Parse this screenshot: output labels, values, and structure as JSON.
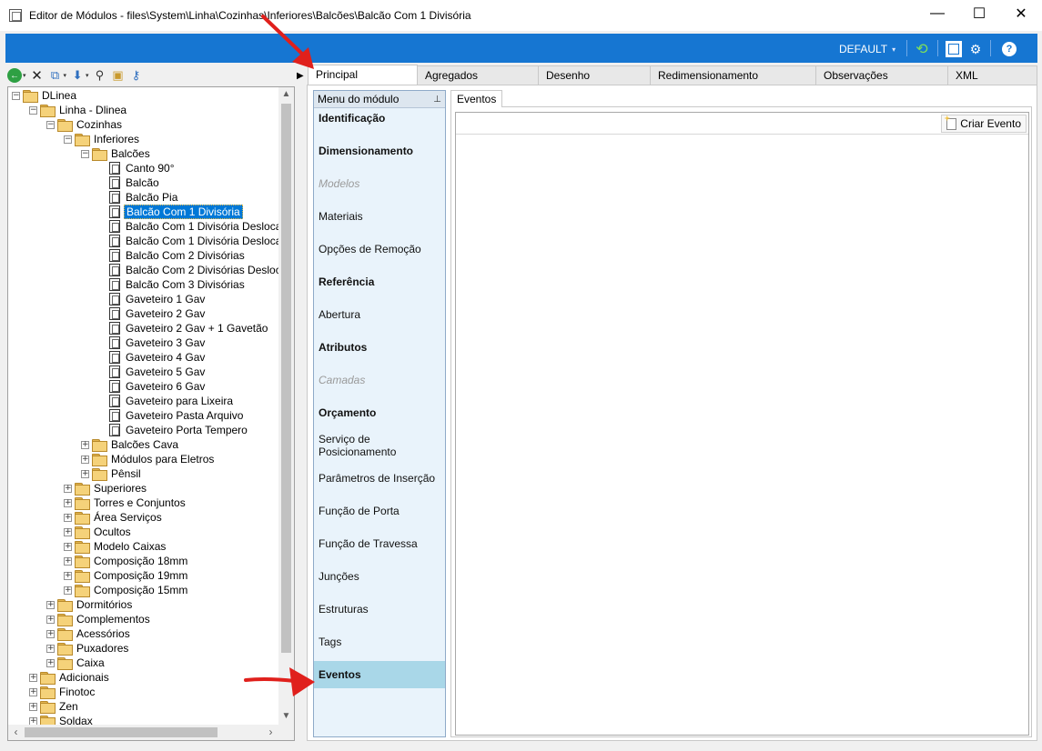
{
  "window": {
    "title": "Editor de Módulos - files\\System\\Linha\\Cozinhas\\Inferiores\\Balcões\\Balcão Com 1 Divisória",
    "minimize": "—",
    "maximize": "☐",
    "close": "✕"
  },
  "ribbon": {
    "profile": "DEFAULT",
    "profile_caret": "▾",
    "icons": [
      "refresh-icon",
      "layout-icon",
      "settings-icon",
      "help-icon"
    ],
    "help_glyph": "?"
  },
  "toolbar": {
    "back_glyph": "←",
    "delete_glyph": "✕",
    "copy_glyph": "⧉",
    "down_glyph": "⬇",
    "find_glyph": "⚲",
    "folder_glyph": "▣",
    "tree_glyph": "⚷",
    "caret": "▾"
  },
  "tree": {
    "items": [
      {
        "label": "DLinea",
        "level": 0,
        "type": "folder",
        "expander": "−"
      },
      {
        "label": "Linha - Dlinea",
        "level": 1,
        "type": "folder",
        "expander": "−"
      },
      {
        "label": "Cozinhas",
        "level": 2,
        "type": "folder",
        "expander": "−"
      },
      {
        "label": "Inferiores",
        "level": 3,
        "type": "folder",
        "expander": "−"
      },
      {
        "label": "Balcões",
        "level": 4,
        "type": "folder",
        "expander": "−"
      },
      {
        "label": "Canto 90°",
        "level": 5,
        "type": "module"
      },
      {
        "label": "Balcão",
        "level": 5,
        "type": "module"
      },
      {
        "label": "Balcão Pia",
        "level": 5,
        "type": "module"
      },
      {
        "label": "Balcão Com 1 Divisória",
        "level": 5,
        "type": "module",
        "selected": true
      },
      {
        "label": "Balcão Com 1 Divisória Desloca",
        "level": 5,
        "type": "module"
      },
      {
        "label": "Balcão Com 1 Divisória Desloca",
        "level": 5,
        "type": "module"
      },
      {
        "label": "Balcão Com 2 Divisórias",
        "level": 5,
        "type": "module"
      },
      {
        "label": "Balcão Com 2 Divisórias Desloc",
        "level": 5,
        "type": "module"
      },
      {
        "label": "Balcão Com 3 Divisórias",
        "level": 5,
        "type": "module"
      },
      {
        "label": "Gaveteiro 1 Gav",
        "level": 5,
        "type": "module"
      },
      {
        "label": "Gaveteiro 2 Gav",
        "level": 5,
        "type": "module"
      },
      {
        "label": "Gaveteiro 2 Gav + 1 Gavetão",
        "level": 5,
        "type": "module"
      },
      {
        "label": "Gaveteiro 3 Gav",
        "level": 5,
        "type": "module"
      },
      {
        "label": "Gaveteiro 4 Gav",
        "level": 5,
        "type": "module"
      },
      {
        "label": "Gaveteiro 5 Gav",
        "level": 5,
        "type": "module"
      },
      {
        "label": "Gaveteiro 6 Gav",
        "level": 5,
        "type": "module"
      },
      {
        "label": "Gaveteiro para Lixeira",
        "level": 5,
        "type": "module"
      },
      {
        "label": "Gaveteiro Pasta Arquivo",
        "level": 5,
        "type": "module"
      },
      {
        "label": "Gaveteiro Porta Tempero",
        "level": 5,
        "type": "module"
      },
      {
        "label": "Balcões Cava",
        "level": 4,
        "type": "folder",
        "expander": "+"
      },
      {
        "label": "Módulos para Eletros",
        "level": 4,
        "type": "folder",
        "expander": "+"
      },
      {
        "label": "Pênsil",
        "level": 4,
        "type": "folder",
        "expander": "+"
      },
      {
        "label": "Superiores",
        "level": 3,
        "type": "folder",
        "expander": "+"
      },
      {
        "label": "Torres e Conjuntos",
        "level": 3,
        "type": "folder",
        "expander": "+"
      },
      {
        "label": "Área Serviços",
        "level": 3,
        "type": "folder",
        "expander": "+"
      },
      {
        "label": "Ocultos",
        "level": 3,
        "type": "folder",
        "expander": "+"
      },
      {
        "label": "Modelo Caixas",
        "level": 3,
        "type": "folder",
        "expander": "+"
      },
      {
        "label": "Composição 18mm",
        "level": 3,
        "type": "folder",
        "expander": "+"
      },
      {
        "label": "Composição 19mm",
        "level": 3,
        "type": "folder",
        "expander": "+"
      },
      {
        "label": "Composição 15mm",
        "level": 3,
        "type": "folder",
        "expander": "+"
      },
      {
        "label": "Dormitórios",
        "level": 2,
        "type": "folder",
        "expander": "+"
      },
      {
        "label": "Complementos",
        "level": 2,
        "type": "folder",
        "expander": "+"
      },
      {
        "label": "Acessórios",
        "level": 2,
        "type": "folder",
        "expander": "+"
      },
      {
        "label": "Puxadores",
        "level": 2,
        "type": "folder",
        "expander": "+"
      },
      {
        "label": "Caixa",
        "level": 2,
        "type": "folder",
        "expander": "+"
      },
      {
        "label": "Adicionais",
        "level": 1,
        "type": "folder",
        "expander": "+"
      },
      {
        "label": "Finotoc",
        "level": 1,
        "type": "folder",
        "expander": "+"
      },
      {
        "label": "Zen",
        "level": 1,
        "type": "folder",
        "expander": "+"
      },
      {
        "label": "Soldax",
        "level": 1,
        "type": "folder",
        "expander": "+"
      }
    ]
  },
  "tabs": [
    {
      "label": "Principal",
      "active": true
    },
    {
      "label": "Agregados"
    },
    {
      "label": "Desenho"
    },
    {
      "label": "Redimensionamento"
    },
    {
      "label": "Observações"
    },
    {
      "label": "XML"
    }
  ],
  "module_menu": {
    "header": "Menu do módulo",
    "pin_glyph": "⊥",
    "items": [
      {
        "label": "Identificação",
        "style": "bold"
      },
      {
        "label": "Dimensionamento",
        "style": "bold"
      },
      {
        "label": "Modelos",
        "style": "disabled"
      },
      {
        "label": "Materiais",
        "style": "normal"
      },
      {
        "label": "Opções de Remoção",
        "style": "normal"
      },
      {
        "label": "Referência",
        "style": "bold"
      },
      {
        "label": "Abertura",
        "style": "normal"
      },
      {
        "label": "Atributos",
        "style": "bold"
      },
      {
        "label": "Camadas",
        "style": "disabled"
      },
      {
        "label": "Orçamento",
        "style": "bold"
      },
      {
        "label": "Serviço de Posicionamento",
        "style": "normal"
      },
      {
        "label": "Parâmetros de Inserção",
        "style": "normal"
      },
      {
        "label": "Função de Porta",
        "style": "normal"
      },
      {
        "label": "Função de Travessa",
        "style": "normal"
      },
      {
        "label": "Junções",
        "style": "normal"
      },
      {
        "label": "Estruturas",
        "style": "normal"
      },
      {
        "label": "Tags",
        "style": "normal"
      },
      {
        "label": "Eventos",
        "style": "bold",
        "active": true
      }
    ]
  },
  "events": {
    "tab_label": "Eventos",
    "create_button": "Criar Evento"
  },
  "colors": {
    "ribbon": "#1676d2",
    "selection": "#0078d7",
    "menu_bg": "#e9f3fb",
    "menu_active": "#a9d7e8",
    "annotation_arrow": "#e0201c"
  }
}
